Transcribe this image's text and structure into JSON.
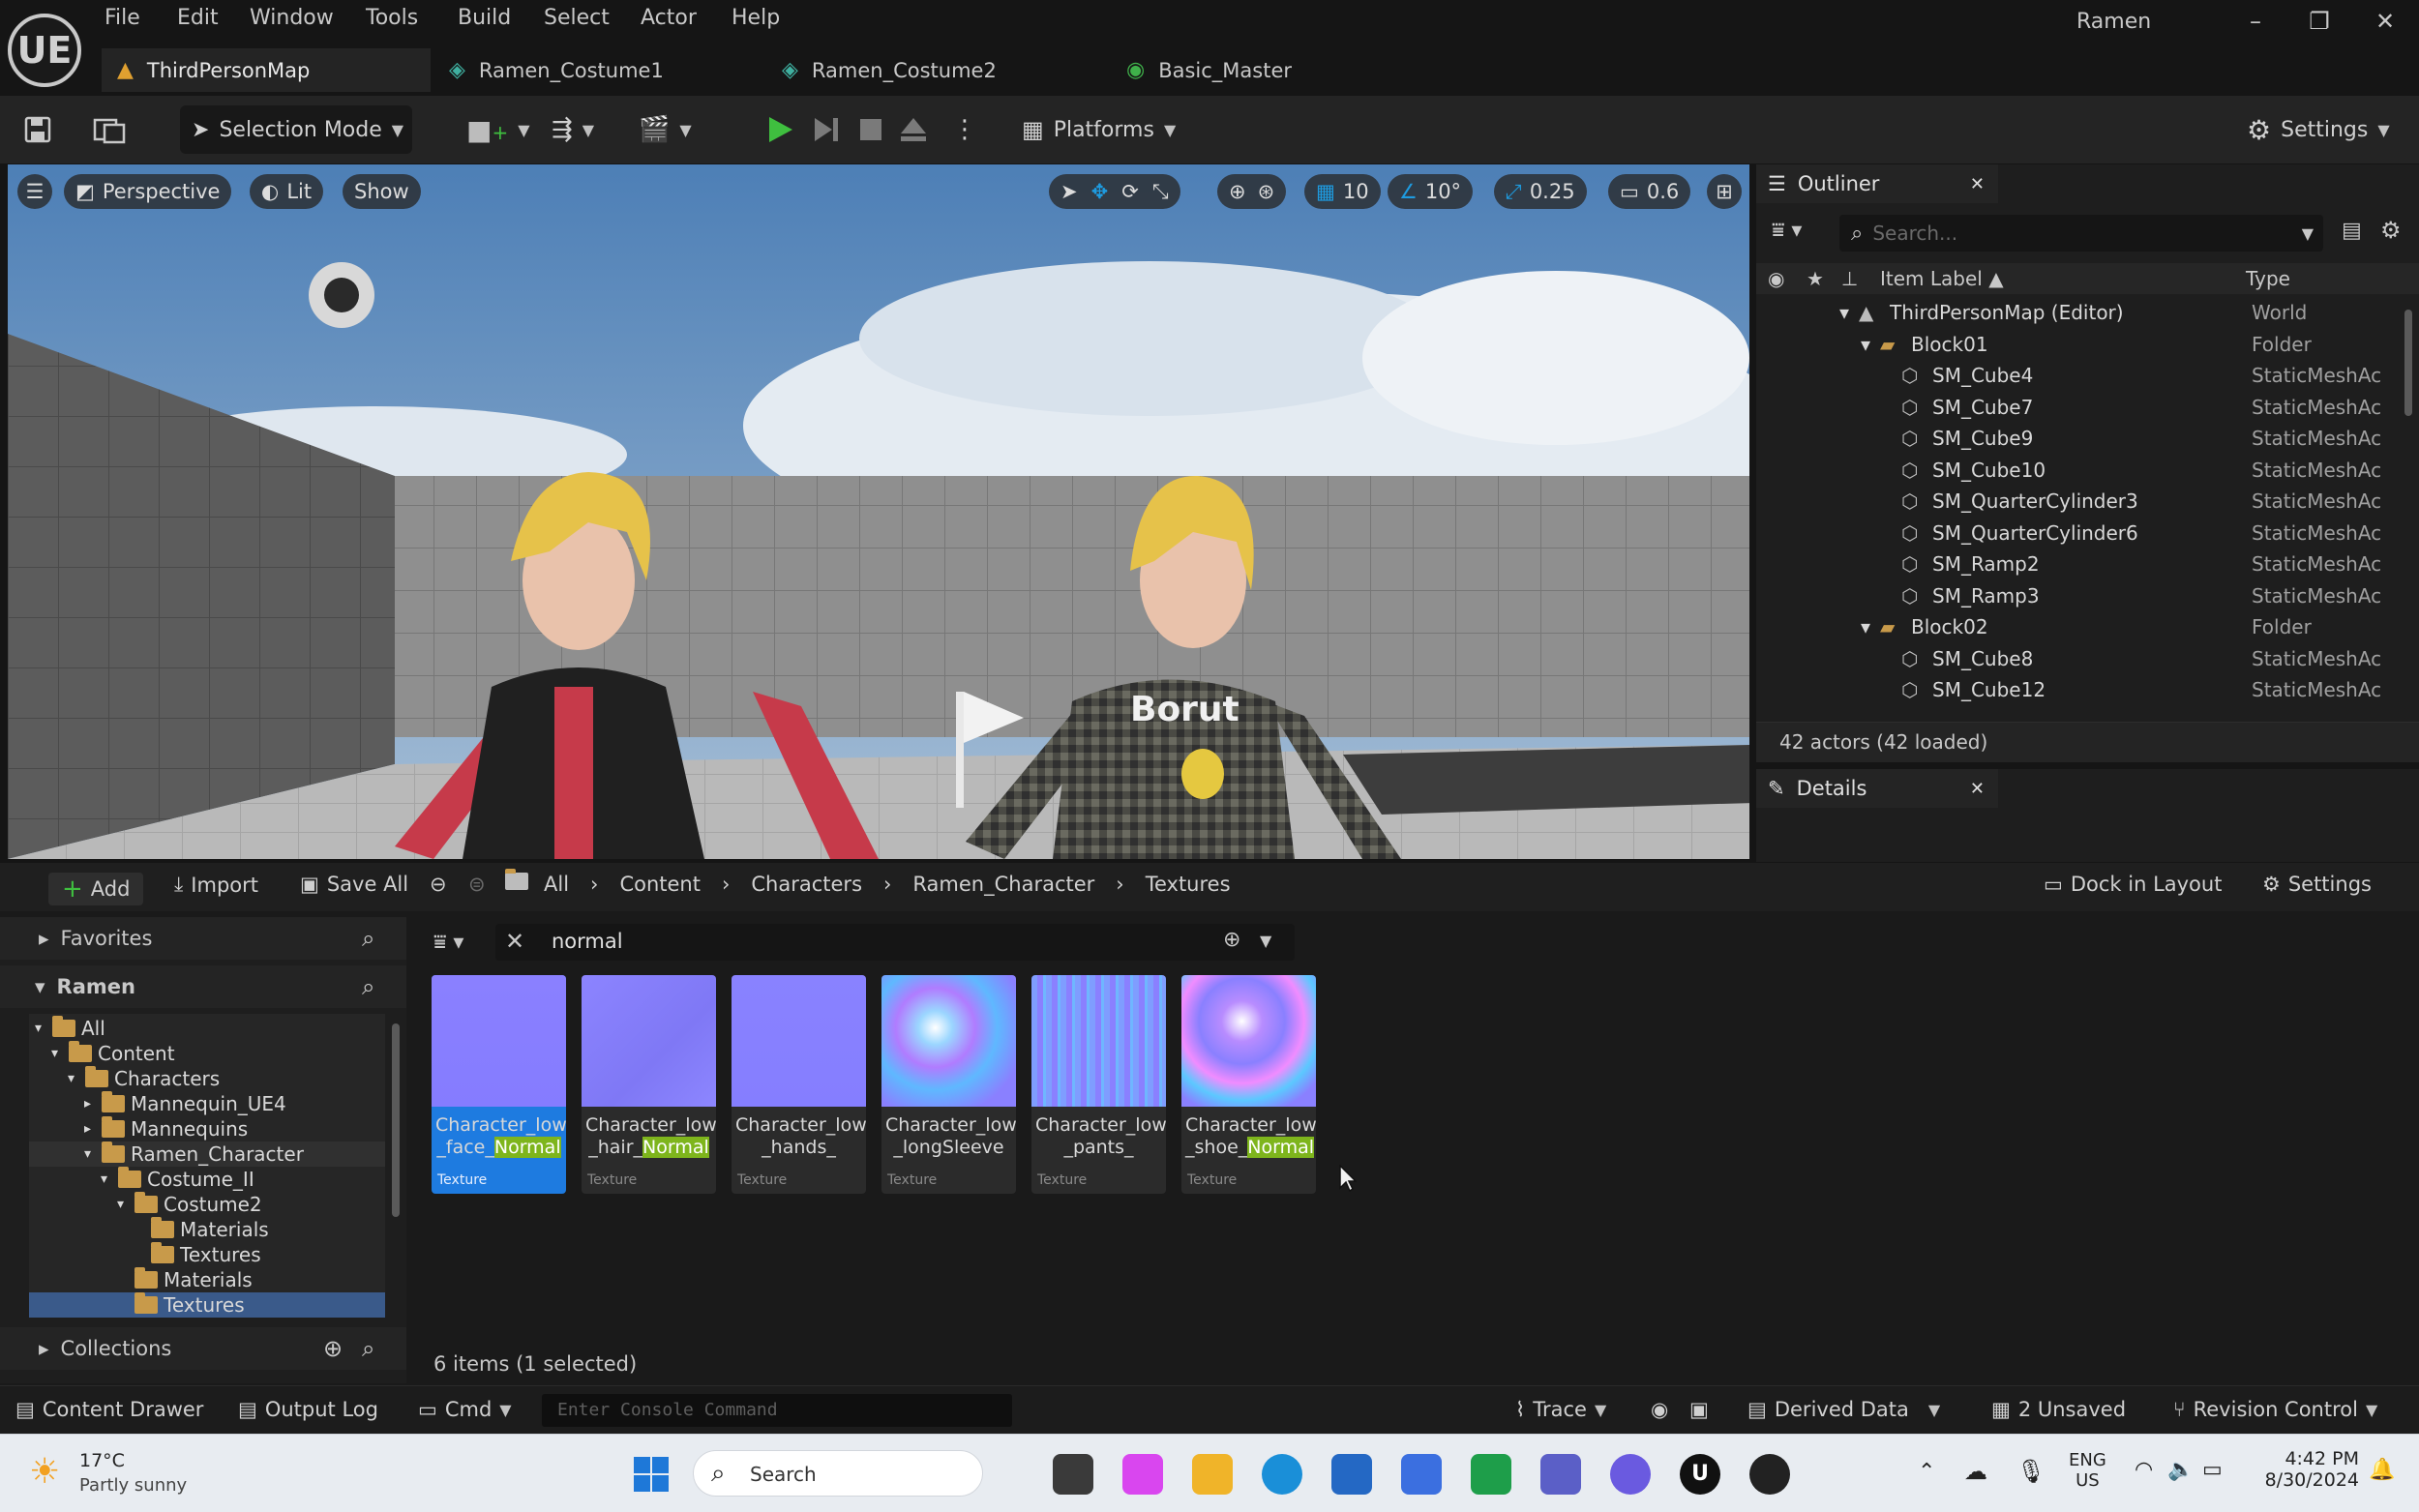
{
  "app": {
    "logo": "UE",
    "menu": [
      "File",
      "Edit",
      "Window",
      "Tools",
      "Build",
      "Select",
      "Actor",
      "Help"
    ],
    "user": "Ramen",
    "tabs": [
      {
        "label": "ThirdPersonMap",
        "active": true
      },
      {
        "label": "Ramen_Costume1"
      },
      {
        "label": "Ramen_Costume2"
      },
      {
        "label": "Basic_Master"
      }
    ]
  },
  "toolbar": {
    "selection_mode": "Selection Mode",
    "platforms": "Platforms",
    "settings": "Settings"
  },
  "viewport": {
    "perspective": "Perspective",
    "lit": "Lit",
    "show": "Show",
    "grid_snap": "10",
    "rot_snap": "10°",
    "scale_snap": "0.25",
    "camera_speed": "0.6"
  },
  "outliner": {
    "title": "Outliner",
    "search_placeholder": "Search...",
    "col_label": "Item Label ▲",
    "col_type": "Type",
    "rows": [
      {
        "label": "ThirdPersonMap (Editor)",
        "type": "World",
        "indent": 0
      },
      {
        "label": "Block01",
        "type": "Folder",
        "indent": 1
      },
      {
        "label": "SM_Cube4",
        "type": "StaticMeshAc",
        "indent": 2
      },
      {
        "label": "SM_Cube7",
        "type": "StaticMeshAc",
        "indent": 2
      },
      {
        "label": "SM_Cube9",
        "type": "StaticMeshAc",
        "indent": 2
      },
      {
        "label": "SM_Cube10",
        "type": "StaticMeshAc",
        "indent": 2
      },
      {
        "label": "SM_QuarterCylinder3",
        "type": "StaticMeshAc",
        "indent": 2
      },
      {
        "label": "SM_QuarterCylinder6",
        "type": "StaticMeshAc",
        "indent": 2
      },
      {
        "label": "SM_Ramp2",
        "type": "StaticMeshAc",
        "indent": 2
      },
      {
        "label": "SM_Ramp3",
        "type": "StaticMeshAc",
        "indent": 2
      },
      {
        "label": "Block02",
        "type": "Folder",
        "indent": 1
      },
      {
        "label": "SM_Cube8",
        "type": "StaticMeshAc",
        "indent": 2
      },
      {
        "label": "SM_Cube12",
        "type": "StaticMeshAc",
        "indent": 2
      }
    ],
    "footer": "42 actors (42 loaded)"
  },
  "details": {
    "title": "Details"
  },
  "content_browser": {
    "add": "Add",
    "import": "Import",
    "save_all": "Save All",
    "breadcrumbs": [
      "All",
      "Content",
      "Characters",
      "Ramen_Character",
      "Textures"
    ],
    "dock_in_layout": "Dock in Layout",
    "settings": "Settings",
    "favorites": "Favorites",
    "project": "Ramen",
    "collections": "Collections",
    "search_value": "normal",
    "tree": [
      {
        "label": "All",
        "indent": 0
      },
      {
        "label": "Content",
        "indent": 1
      },
      {
        "label": "Characters",
        "indent": 2
      },
      {
        "label": "Mannequin_UE4",
        "indent": 3
      },
      {
        "label": "Mannequins",
        "indent": 3
      },
      {
        "label": "Ramen_Character",
        "indent": 3
      },
      {
        "label": "Costume_II",
        "indent": 4
      },
      {
        "label": "Costume2",
        "indent": 5
      },
      {
        "label": "Materials",
        "indent": 6
      },
      {
        "label": "Textures",
        "indent": 6
      },
      {
        "label": "Materials",
        "indent": 5
      },
      {
        "label": "Textures",
        "indent": 5
      }
    ],
    "assets": [
      {
        "line1": "Character_low",
        "line2a": "_face_",
        "line2b": "Normal",
        "kind": "Texture",
        "selected": true
      },
      {
        "line1": "Character_low",
        "line2a": "_hair_",
        "line2b": "Normal",
        "kind": "Texture"
      },
      {
        "line1": "Character_low",
        "line2a": "_hands_",
        "line2b": "",
        "kind": "Texture"
      },
      {
        "line1": "Character_low",
        "line2a": "_longSleeve",
        "line2b": "",
        "kind": "Texture"
      },
      {
        "line1": "Character_low",
        "line2a": "_pants_",
        "line2b": "",
        "kind": "Texture"
      },
      {
        "line1": "Character_low",
        "line2a": "_shoe_",
        "line2b": "Normal",
        "kind": "Texture"
      }
    ],
    "count": "6 items (1 selected)"
  },
  "statusbar": {
    "content_drawer": "Content Drawer",
    "output_log": "Output Log",
    "cmd": "Cmd",
    "console_placeholder": "Enter Console Command",
    "trace": "Trace",
    "derived_data": "Derived Data",
    "unsaved": "2 Unsaved",
    "revision_control": "Revision Control"
  },
  "taskbar": {
    "temp": "17°C",
    "weather": "Partly sunny",
    "search": "Search",
    "lang1": "ENG",
    "lang2": "US",
    "time": "4:42 PM",
    "date": "8/30/2024"
  },
  "colors": {
    "accent": "#1e7be0",
    "play_green": "#3fbf3f",
    "normal_map": "#8a80ff",
    "highlight": "#7eb51c"
  }
}
